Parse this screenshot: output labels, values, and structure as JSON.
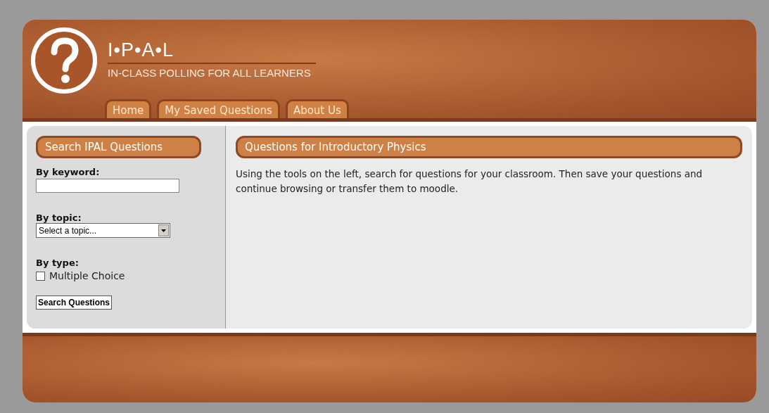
{
  "logo": {
    "title": "I•P•A•L",
    "subtitle": "IN-CLASS POLLING FOR ALL LEARNERS"
  },
  "tabs": [
    {
      "label": "Home"
    },
    {
      "label": "My Saved Questions"
    },
    {
      "label": "About Us"
    }
  ],
  "sidebar": {
    "heading": "Search IPAL Questions",
    "keyword": {
      "label": "By keyword:"
    },
    "topic": {
      "label": "By topic:",
      "value": "Select a topic..."
    },
    "type": {
      "label": "By type:",
      "options": [
        {
          "label": "Multiple Choice",
          "checked": false
        }
      ]
    },
    "button": "Search Questions"
  },
  "main": {
    "heading": "Questions for Introductory Physics",
    "text": "Using the tools on the left, search for questions for your classroom. Then save your questions and continue browsing or transfer them to moodle."
  }
}
